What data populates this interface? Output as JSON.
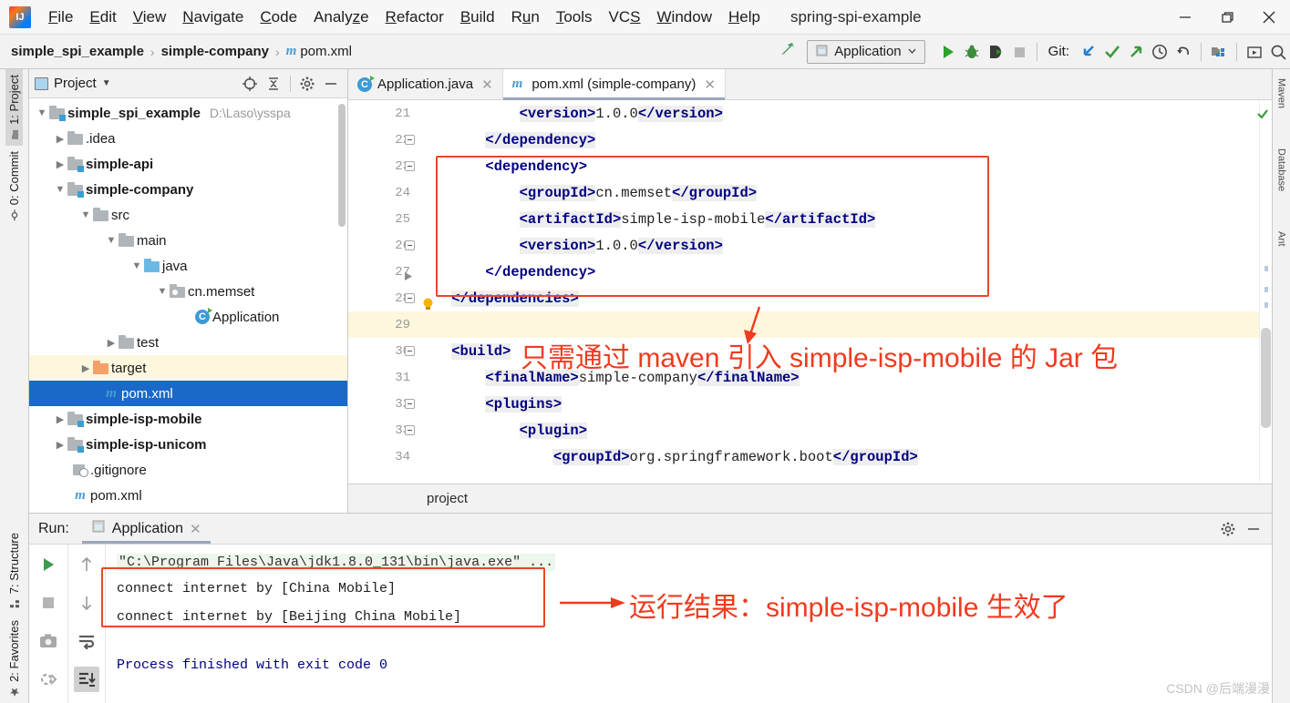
{
  "window": {
    "title": "spring-spi-example",
    "minimize": "─",
    "maximize": "❐",
    "close": "✕"
  },
  "menubar": {
    "items": [
      {
        "label": "File",
        "mnemonic": "F"
      },
      {
        "label": "Edit",
        "mnemonic": "E"
      },
      {
        "label": "View",
        "mnemonic": "V"
      },
      {
        "label": "Navigate",
        "mnemonic": "N"
      },
      {
        "label": "Code",
        "mnemonic": "C"
      },
      {
        "label": "Analyze",
        "mnemonic": "z"
      },
      {
        "label": "Refactor",
        "mnemonic": "R"
      },
      {
        "label": "Build",
        "mnemonic": "B"
      },
      {
        "label": "Run",
        "mnemonic": "u"
      },
      {
        "label": "Tools",
        "mnemonic": "T"
      },
      {
        "label": "VCS",
        "mnemonic": "S"
      },
      {
        "label": "Window",
        "mnemonic": "W"
      },
      {
        "label": "Help",
        "mnemonic": "H"
      }
    ]
  },
  "navbar": {
    "breadcrumbs": [
      {
        "label": "simple_spi_example",
        "icon": ""
      },
      {
        "label": "simple-company",
        "icon": ""
      },
      {
        "label": "pom.xml",
        "icon": "maven-m-icon"
      }
    ],
    "separator": "›",
    "build_icon": "hammer-icon",
    "run_config": {
      "label": "Application",
      "icon": "run-config-icon",
      "chevron": "∨"
    },
    "actions": [
      {
        "name": "run-button",
        "icon": "play-icon",
        "color": "#29a329"
      },
      {
        "name": "debug-button",
        "icon": "bug-icon",
        "color": "#3c8c3c"
      },
      {
        "name": "run-with-coverage-button",
        "icon": "coverage-icon",
        "color": "#4a4a4a"
      },
      {
        "name": "stop-button",
        "icon": "stop-square-icon",
        "color": "#b0b0b0"
      }
    ],
    "git_label": "Git:",
    "git_actions": [
      {
        "name": "update-project-button",
        "icon": "arrow-down-left-icon",
        "color": "#2c7fd0"
      },
      {
        "name": "commit-button",
        "icon": "check-icon",
        "color": "#3c9a3c"
      },
      {
        "name": "push-button",
        "icon": "arrow-up-right-icon",
        "color": "#3c9a3c"
      },
      {
        "name": "history-button",
        "icon": "clock-icon",
        "color": "#4a4a4a"
      },
      {
        "name": "rollback-button",
        "icon": "undo-arrow-icon",
        "color": "#4a4a4a"
      }
    ],
    "right_actions": [
      {
        "name": "project-structure-button",
        "icon": "project-structure-icon"
      },
      {
        "name": "select-in-button",
        "icon": "select-in-icon"
      },
      {
        "name": "search-everywhere-button",
        "icon": "search-icon"
      }
    ]
  },
  "left_tool_strip": {
    "tabs": [
      {
        "label": "1: Project",
        "mnemonic": "1",
        "selected": true,
        "icon": "project-folder-icon"
      },
      {
        "label": "0: Commit",
        "mnemonic": "0",
        "selected": false,
        "icon": "commit-icon"
      }
    ],
    "bottom_tabs": [
      {
        "label": "7: Structure",
        "mnemonic": "7",
        "icon": "structure-icon"
      },
      {
        "label": "2: Favorites",
        "mnemonic": "2",
        "icon": "favorites-icon"
      }
    ]
  },
  "right_tool_strip": {
    "tabs": [
      "Maven",
      "Database",
      "Ant"
    ]
  },
  "project_panel": {
    "title": "Project",
    "chevron": "▾",
    "icons": [
      {
        "name": "scroll-from-source-icon",
        "glyph": "⊕"
      },
      {
        "name": "collapse-all-icon",
        "glyph": "≡"
      },
      {
        "name": "settings-gear-icon",
        "glyph": "⚙"
      },
      {
        "name": "hide-panel-icon",
        "glyph": "─"
      }
    ],
    "tree": [
      {
        "depth": 0,
        "arrow": "down",
        "icon": "module-folder",
        "label": "simple_spi_example",
        "bold": true,
        "path": "D:\\Laso\\ysspa",
        "state": "normal"
      },
      {
        "depth": 1,
        "arrow": "right",
        "icon": "folder",
        "label": ".idea",
        "bold": false,
        "path": "",
        "state": "normal"
      },
      {
        "depth": 1,
        "arrow": "right",
        "icon": "module-folder",
        "label": "simple-api",
        "bold": true,
        "path": "",
        "state": "normal"
      },
      {
        "depth": 1,
        "arrow": "down",
        "icon": "module-folder",
        "label": "simple-company",
        "bold": true,
        "path": "",
        "state": "normal"
      },
      {
        "depth": 2,
        "arrow": "down",
        "icon": "folder",
        "label": "src",
        "bold": false,
        "path": "",
        "state": "normal"
      },
      {
        "depth": 3,
        "arrow": "down",
        "icon": "folder",
        "label": "main",
        "bold": false,
        "path": "",
        "state": "normal"
      },
      {
        "depth": 4,
        "arrow": "down",
        "icon": "source-folder",
        "label": "java",
        "bold": false,
        "path": "",
        "state": "normal"
      },
      {
        "depth": 5,
        "arrow": "down",
        "icon": "package",
        "label": "cn.memset",
        "bold": false,
        "path": "",
        "state": "normal"
      },
      {
        "depth": 6,
        "arrow": "none",
        "icon": "java-class",
        "label": "Application",
        "bold": false,
        "path": "",
        "state": "normal"
      },
      {
        "depth": 3,
        "arrow": "right",
        "icon": "folder",
        "label": "test",
        "bold": false,
        "path": "",
        "state": "normal"
      },
      {
        "depth": 2,
        "arrow": "right",
        "icon": "target-folder",
        "label": "target",
        "bold": false,
        "path": "",
        "state": "highlighted"
      },
      {
        "depth": 3,
        "arrow": "none",
        "icon": "maven-pom",
        "label": "pom.xml",
        "bold": false,
        "path": "",
        "state": "selected"
      },
      {
        "depth": 1,
        "arrow": "right",
        "icon": "module-folder",
        "label": "simple-isp-mobile",
        "bold": true,
        "path": "",
        "state": "normal"
      },
      {
        "depth": 1,
        "arrow": "right",
        "icon": "module-folder",
        "label": "simple-isp-unicom",
        "bold": true,
        "path": "",
        "state": "normal"
      },
      {
        "depth": 1,
        "arrow": "none",
        "icon": "gitignore",
        "label": ".gitignore",
        "bold": false,
        "path": "",
        "state": "normal"
      },
      {
        "depth": 1,
        "arrow": "none",
        "icon": "maven-pom",
        "label": "pom.xml",
        "bold": false,
        "path": "",
        "state": "normal"
      }
    ]
  },
  "editor": {
    "tabs": [
      {
        "label": "Application.java",
        "icon": "java-class-icon",
        "active": false,
        "close": "✕"
      },
      {
        "label": "pom.xml (simple-company)",
        "icon": "maven-m-icon",
        "active": true,
        "close": "✕"
      }
    ],
    "line_numbers": [
      "21",
      "22",
      "23",
      "24",
      "25",
      "26",
      "27",
      "28",
      "29",
      "30",
      "31",
      "32",
      "33",
      "34"
    ],
    "lines": [
      {
        "num": "21",
        "segments": [
          {
            "t": "            ",
            "k": "p"
          },
          {
            "t": "<version>",
            "k": "tag"
          },
          {
            "t": "1.0.0",
            "k": "val"
          },
          {
            "t": "</version>",
            "k": "tag"
          }
        ]
      },
      {
        "num": "22",
        "segments": [
          {
            "t": "        ",
            "k": "p"
          },
          {
            "t": "</dependency>",
            "k": "tag"
          }
        ]
      },
      {
        "num": "23",
        "segments": [
          {
            "t": "        ",
            "k": "p"
          },
          {
            "t": "<dependency>",
            "k": "tag"
          }
        ]
      },
      {
        "num": "24",
        "segments": [
          {
            "t": "            ",
            "k": "p"
          },
          {
            "t": "<groupId>",
            "k": "tag"
          },
          {
            "t": "cn.memset",
            "k": "val"
          },
          {
            "t": "</groupId>",
            "k": "tag"
          }
        ]
      },
      {
        "num": "25",
        "segments": [
          {
            "t": "            ",
            "k": "p"
          },
          {
            "t": "<artifactId>",
            "k": "tag"
          },
          {
            "t": "simple-isp-mobile",
            "k": "val"
          },
          {
            "t": "</artifactId>",
            "k": "tag"
          }
        ]
      },
      {
        "num": "26",
        "segments": [
          {
            "t": "            ",
            "k": "p"
          },
          {
            "t": "<version>",
            "k": "tag"
          },
          {
            "t": "1.0.0",
            "k": "val"
          },
          {
            "t": "</version>",
            "k": "tag"
          }
        ]
      },
      {
        "num": "27",
        "segments": [
          {
            "t": "        ",
            "k": "p"
          },
          {
            "t": "</dependency>",
            "k": "tag"
          }
        ]
      },
      {
        "num": "28",
        "segments": [
          {
            "t": "    ",
            "k": "p"
          },
          {
            "t": "</dependencies>",
            "k": "tag"
          }
        ]
      },
      {
        "num": "29",
        "segments": [
          {
            "t": "",
            "k": "p"
          }
        ]
      },
      {
        "num": "30",
        "segments": [
          {
            "t": "    ",
            "k": "p"
          },
          {
            "t": "<build>",
            "k": "tag"
          }
        ]
      },
      {
        "num": "31",
        "segments": [
          {
            "t": "        ",
            "k": "p"
          },
          {
            "t": "<finalName>",
            "k": "tag"
          },
          {
            "t": "simple-company",
            "k": "val"
          },
          {
            "t": "</finalName>",
            "k": "tag"
          }
        ]
      },
      {
        "num": "32",
        "segments": [
          {
            "t": "        ",
            "k": "p"
          },
          {
            "t": "<plugins>",
            "k": "tag"
          }
        ]
      },
      {
        "num": "33",
        "segments": [
          {
            "t": "            ",
            "k": "p"
          },
          {
            "t": "<plugin>",
            "k": "tag"
          }
        ]
      },
      {
        "num": "34",
        "segments": [
          {
            "t": "                ",
            "k": "p"
          },
          {
            "t": "<groupId>",
            "k": "tag"
          },
          {
            "t": "org.springframework.boot",
            "k": "val"
          },
          {
            "t": "</groupId>",
            "k": "tag"
          }
        ]
      }
    ],
    "breadcrumb": "project",
    "inspection_ok_icon": "green-check-icon",
    "intention_bulb_icon": "lightbulb-icon"
  },
  "annotations": {
    "editor_note": "只需通过 maven 引入 simple-isp-mobile 的 Jar 包",
    "console_note": "运行结果：simple-isp-mobile 生效了",
    "color": "#ef3b1f"
  },
  "run_panel": {
    "label": "Run:",
    "tab": {
      "label": "Application",
      "icon": "run-config-icon",
      "close": "✕"
    },
    "header_icons": [
      {
        "name": "settings-gear-icon",
        "glyph": "⚙"
      },
      {
        "name": "hide-panel-icon",
        "glyph": "─"
      }
    ],
    "tools_left": [
      {
        "name": "rerun-button",
        "icon": "play-icon"
      },
      {
        "name": "stop-button",
        "icon": "stop-square-icon"
      },
      {
        "name": "dump-threads-button",
        "icon": "camera-icon"
      },
      {
        "name": "restart-button",
        "icon": "restart-icon"
      }
    ],
    "tools_right": [
      {
        "name": "up-stack-button",
        "icon": "arrow-up-icon"
      },
      {
        "name": "down-stack-button",
        "icon": "arrow-down-icon"
      },
      {
        "name": "soft-wrap-button",
        "icon": "wrap-text-icon"
      },
      {
        "name": "scroll-to-end-button",
        "icon": "scroll-to-end-icon",
        "selected": true
      }
    ],
    "console": {
      "command": "\"C:\\Program Files\\Java\\jdk1.8.0_131\\bin\\java.exe\" ...",
      "output": [
        "connect internet by [China Mobile]",
        "connect internet by [Beijing China Mobile]"
      ],
      "exit": "Process finished with exit code 0"
    }
  },
  "watermark": "CSDN @后端漫漫"
}
